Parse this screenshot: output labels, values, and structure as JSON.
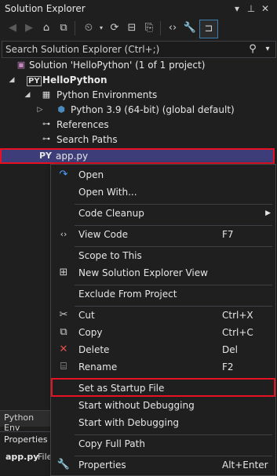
{
  "window": {
    "title": "Solution Explorer",
    "title_icons": [
      "dropdown-icon",
      "pin-icon",
      "close-icon"
    ]
  },
  "search": {
    "placeholder": "Search Solution Explorer (Ctrl+;)",
    "value": ""
  },
  "tree": {
    "solution_label": "Solution 'HelloPython' (1 of 1 project)",
    "project_label": "HelloPython",
    "project_badge": "PY",
    "env_folder_label": "Python Environments",
    "env_label": "Python 3.9 (64-bit) (global default)",
    "references_label": "References",
    "search_paths_label": "Search Paths",
    "file_badge": "PY",
    "file_label": "app.py"
  },
  "bottom": {
    "tab_label": "Python Env",
    "properties_header": "Properties",
    "properties_item": "app.py",
    "properties_item_suffix": "File"
  },
  "menu": {
    "open": "Open",
    "open_with": "Open With...",
    "code_cleanup": "Code Cleanup",
    "view_code": "View Code",
    "view_code_sc": "F7",
    "scope_to_this": "Scope to This",
    "new_view": "New Solution Explorer View",
    "exclude": "Exclude From Project",
    "cut": "Cut",
    "cut_sc": "Ctrl+X",
    "copy": "Copy",
    "copy_sc": "Ctrl+C",
    "delete": "Delete",
    "delete_sc": "Del",
    "rename": "Rename",
    "rename_sc": "F2",
    "set_startup": "Set as Startup File",
    "start_without": "Start without Debugging",
    "start_with": "Start with Debugging",
    "copy_full_path": "Copy Full Path",
    "properties": "Properties",
    "properties_sc": "Alt+Enter"
  },
  "colors": {
    "selection": "#3d3d79",
    "highlight_border": "#e81123",
    "delete_icon": "#e05252",
    "open_icon": "#4aa3ff"
  }
}
